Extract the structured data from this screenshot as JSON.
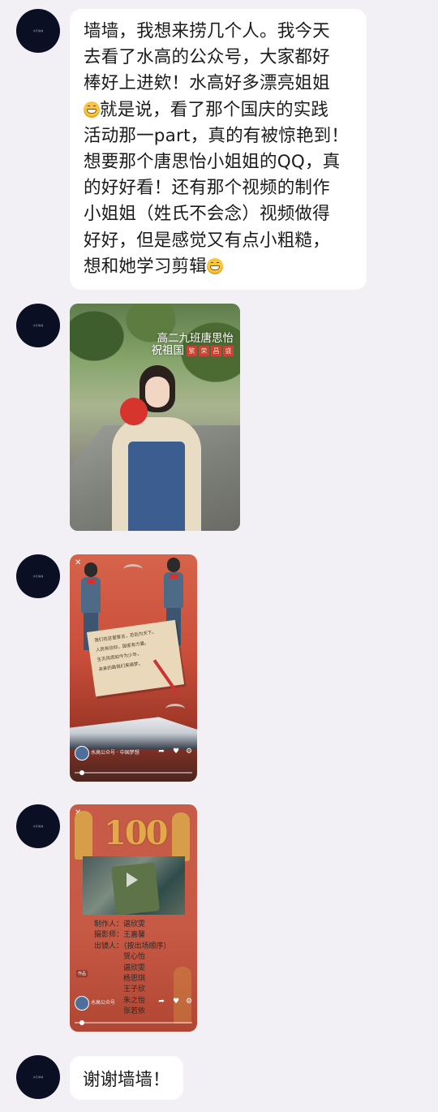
{
  "messages": [
    {
      "type": "text",
      "avatar_text": "水高墙墙",
      "lines": [
        "墙墙，我想来捞几个人。我今天",
        "去看了水高的公众号，大家都好",
        "棒好上进欸！水高好多漂亮姐姐",
        "就是说，看了那个国庆的实践",
        "活动那一part，真的有被惊艳到！",
        "想要那个唐思怡小姐姐的QQ，真",
        "的好好看！还有那个视频的制作",
        "小姐姐（姓氏不会念）视频做得",
        "好好，但是感觉又有点小粗糙，",
        "想和她学习剪辑"
      ],
      "emoji_icon": "grinning-face-emoji"
    },
    {
      "type": "image",
      "avatar_text": "水高墙墙",
      "caption_line1": "高二九班唐思怡",
      "caption_line2": "祝祖国",
      "caption_tags": [
        "繁",
        "荣",
        "昌",
        "盛"
      ]
    },
    {
      "type": "video",
      "avatar_text": "水高墙墙",
      "letter_lines": [
        "我们在这里誓言，恐后为天下。",
        "人民有信仰，国家有力量。",
        "生灭风雨如今为少年，",
        "未来的路我们来铸梦。"
      ],
      "channel_name": "水高公众号 · 中国梦想"
    },
    {
      "type": "video",
      "avatar_text": "水高墙墙",
      "title_number": "100",
      "credits": [
        "制作人：谌欣雯",
        "摄影师：王嘉馨",
        "出镜人：（按出场顺序）",
        "贺心怡",
        "谌欣雯",
        "杨思琪",
        "王子欣",
        "朱之怡",
        "张若依"
      ],
      "badge": "作品",
      "channel_name": "水高公众号"
    },
    {
      "type": "text",
      "avatar_text": "水高墙墙",
      "text": "谢谢墙墙！"
    }
  ],
  "colors": {
    "background": "#f3f0f5",
    "bubble": "#ffffff",
    "avatar": "#0b0f23"
  }
}
